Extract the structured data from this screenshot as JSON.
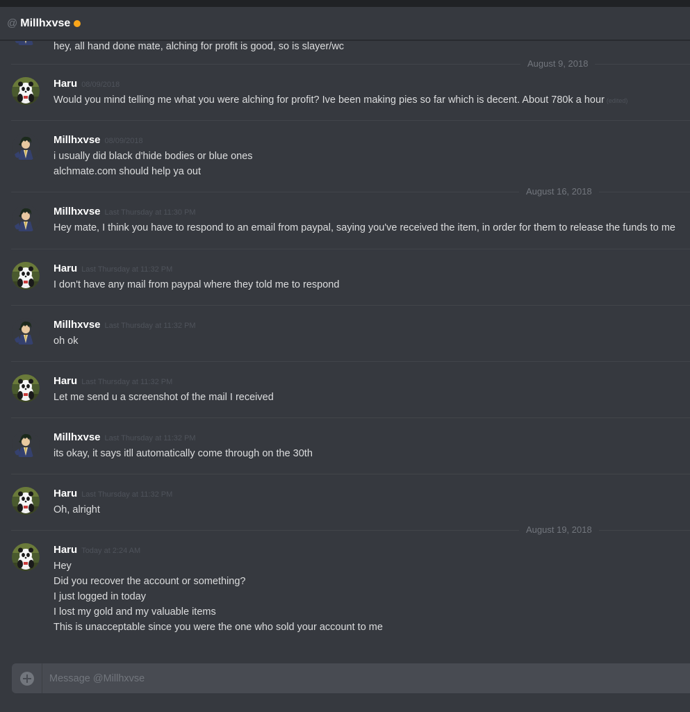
{
  "header": {
    "at_symbol": "@",
    "recipient": "Millhxvse",
    "status_color": "#faa61a"
  },
  "colors": {
    "background": "#36393f",
    "username": "#ffffff",
    "message_text": "#dcddde",
    "timestamp": "#4f535b"
  },
  "partial_message": {
    "author": "Millhxvse",
    "text": "hey, all hand done mate, alching for profit is good, so is slayer/wc"
  },
  "dividers": {
    "aug9": "August 9, 2018",
    "aug16": "August 16, 2018",
    "aug19": "August 19, 2018"
  },
  "messages": [
    {
      "author": "Haru",
      "avatar": "panda",
      "timestamp": "08/09/2018",
      "lines": [
        "Would you mind telling me what you were alching for profit? Ive been making pies so far which is decent. About 780k a hour"
      ],
      "edited": "(edited)"
    },
    {
      "author": "Millhxvse",
      "avatar": "anime-character",
      "timestamp": "08/09/2018",
      "lines": [
        "i usually did black d'hide bodies or blue ones",
        "alchmate.com should help ya out"
      ]
    },
    {
      "author": "Millhxvse",
      "avatar": "anime-character",
      "timestamp": "Last Thursday at 11:30 PM",
      "lines": [
        "Hey mate, I think you have to respond to an email from paypal, saying you've received the item, in order for them to release the funds to me"
      ]
    },
    {
      "author": "Haru",
      "avatar": "panda",
      "timestamp": "Last Thursday at 11:32 PM",
      "lines": [
        "I don't have any mail from paypal where they told me to respond"
      ]
    },
    {
      "author": "Millhxvse",
      "avatar": "anime-character",
      "timestamp": "Last Thursday at 11:32 PM",
      "lines": [
        "oh ok"
      ]
    },
    {
      "author": "Haru",
      "avatar": "panda",
      "timestamp": "Last Thursday at 11:32 PM",
      "lines": [
        "Let me send u a screenshot of the mail I received"
      ]
    },
    {
      "author": "Millhxvse",
      "avatar": "anime-character",
      "timestamp": "Last Thursday at 11:32 PM",
      "lines": [
        "its okay, it says itll automatically come through on the 30th"
      ]
    },
    {
      "author": "Haru",
      "avatar": "panda",
      "timestamp": "Last Thursday at 11:32 PM",
      "lines": [
        "Oh, alright"
      ]
    },
    {
      "author": "Haru",
      "avatar": "panda",
      "timestamp": "Today at 2:24 AM",
      "lines": [
        "Hey",
        "Did you recover the account or something?",
        "I just logged in today",
        "I lost my gold and my valuable items",
        "This is unacceptable since you were the one who sold your account to me"
      ]
    }
  ],
  "composer": {
    "placeholder": "Message @Millhxvse",
    "attach_icon": "plus-circle-icon"
  }
}
